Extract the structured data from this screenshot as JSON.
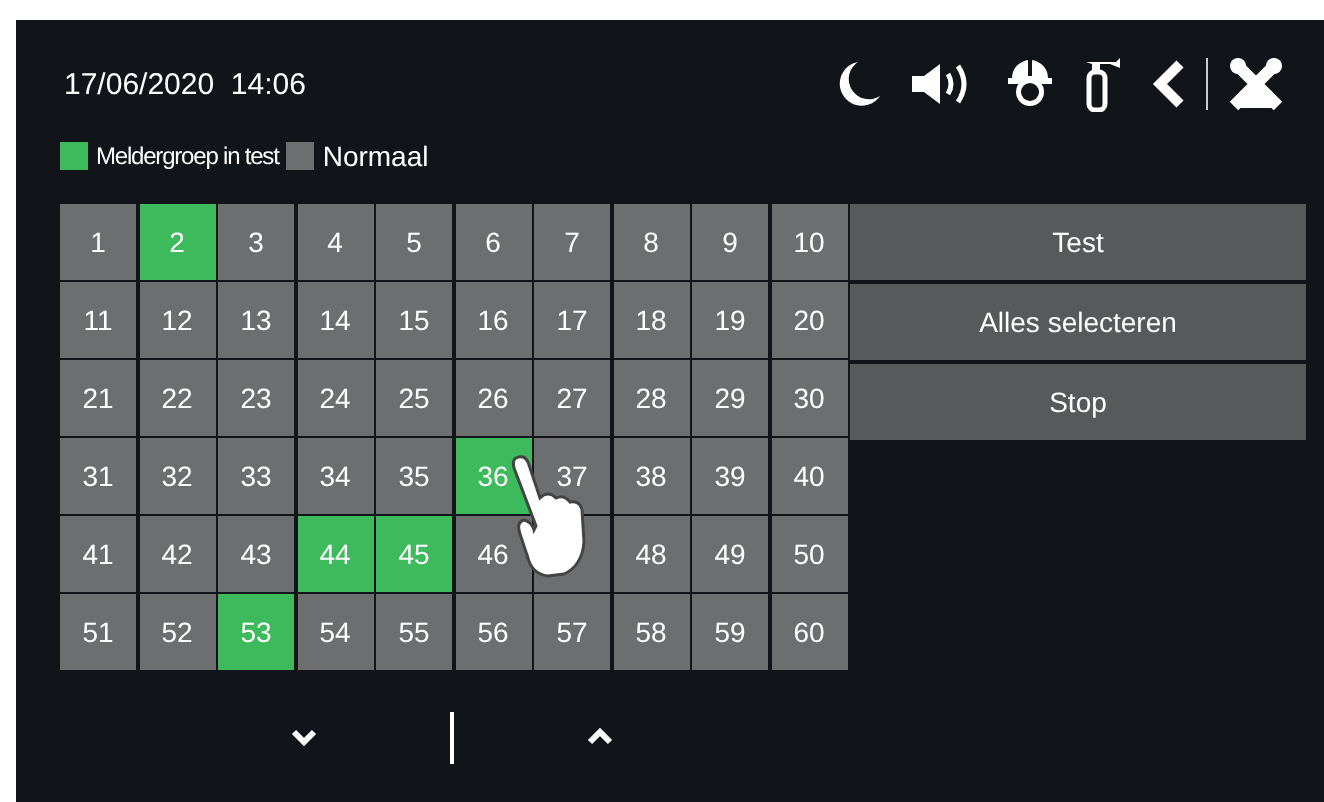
{
  "header": {
    "datetime": "17/06/2020  14:06"
  },
  "legend": [
    {
      "label": "Meldergroep in test",
      "color": "#3dba5c"
    },
    {
      "label": "Normaal",
      "color": "#6d6e70"
    }
  ],
  "cells": [
    {
      "label": "1",
      "selected": false
    },
    {
      "label": "2",
      "selected": true
    },
    {
      "label": "3",
      "selected": false
    },
    {
      "label": "4",
      "selected": false
    },
    {
      "label": "5",
      "selected": false
    },
    {
      "label": "6",
      "selected": false
    },
    {
      "label": "7",
      "selected": false
    },
    {
      "label": "8",
      "selected": false
    },
    {
      "label": "9",
      "selected": false
    },
    {
      "label": "10",
      "selected": false
    },
    {
      "label": "11",
      "selected": false
    },
    {
      "label": "12",
      "selected": false
    },
    {
      "label": "13",
      "selected": false
    },
    {
      "label": "14",
      "selected": false
    },
    {
      "label": "15",
      "selected": false
    },
    {
      "label": "16",
      "selected": false
    },
    {
      "label": "17",
      "selected": false
    },
    {
      "label": "18",
      "selected": false
    },
    {
      "label": "19",
      "selected": false
    },
    {
      "label": "20",
      "selected": false
    },
    {
      "label": "21",
      "selected": false
    },
    {
      "label": "22",
      "selected": false
    },
    {
      "label": "23",
      "selected": false
    },
    {
      "label": "24",
      "selected": false
    },
    {
      "label": "25",
      "selected": false
    },
    {
      "label": "26",
      "selected": false
    },
    {
      "label": "27",
      "selected": false
    },
    {
      "label": "28",
      "selected": false
    },
    {
      "label": "29",
      "selected": false
    },
    {
      "label": "30",
      "selected": false
    },
    {
      "label": "31",
      "selected": false
    },
    {
      "label": "32",
      "selected": false
    },
    {
      "label": "33",
      "selected": false
    },
    {
      "label": "34",
      "selected": false
    },
    {
      "label": "35",
      "selected": false
    },
    {
      "label": "36",
      "selected": true
    },
    {
      "label": "37",
      "selected": false
    },
    {
      "label": "38",
      "selected": false
    },
    {
      "label": "39",
      "selected": false
    },
    {
      "label": "40",
      "selected": false
    },
    {
      "label": "41",
      "selected": false
    },
    {
      "label": "42",
      "selected": false
    },
    {
      "label": "43",
      "selected": false
    },
    {
      "label": "44",
      "selected": true
    },
    {
      "label": "45",
      "selected": true
    },
    {
      "label": "46",
      "selected": false
    },
    {
      "selected": false
    },
    {
      "label": "48",
      "selected": false
    },
    {
      "label": "49",
      "selected": false
    },
    {
      "label": "50",
      "selected": false
    },
    {
      "label": "51",
      "selected": false
    },
    {
      "label": "52",
      "selected": false
    },
    {
      "label": "53",
      "selected": true
    },
    {
      "label": "54",
      "selected": false
    },
    {
      "label": "55",
      "selected": false
    },
    {
      "label": "56",
      "selected": false
    },
    {
      "label": "57",
      "selected": false
    },
    {
      "label": "58",
      "selected": false
    },
    {
      "label": "59",
      "selected": false
    },
    {
      "label": "60",
      "selected": false
    }
  ],
  "actions": [
    "Test",
    "Alles selecteren",
    "Stop"
  ]
}
